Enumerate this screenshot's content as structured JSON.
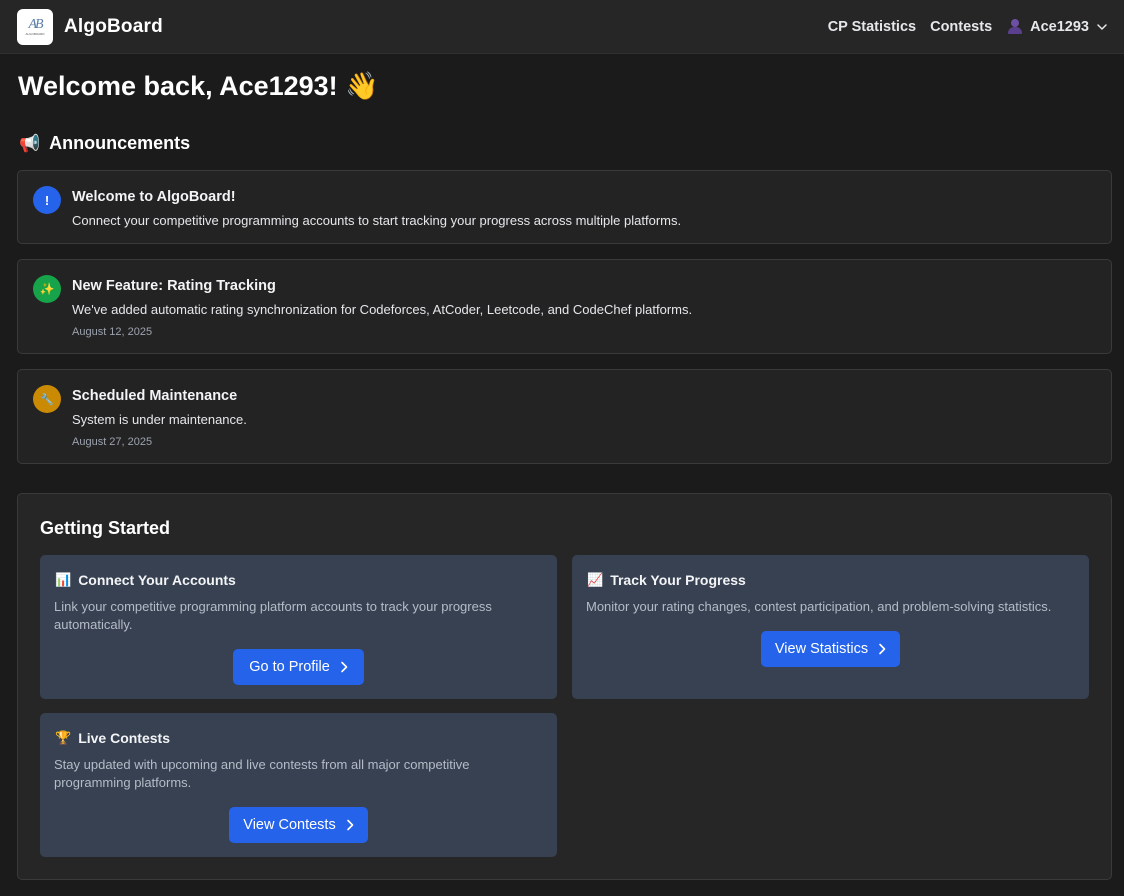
{
  "navbar": {
    "logo_text": "AB",
    "logo_subtext": "ALGOBOARD",
    "brand": "AlgoBoard",
    "links": [
      "CP Statistics",
      "Contests"
    ],
    "username": "Ace1293"
  },
  "welcome": "Welcome back, Ace1293! 👋",
  "announcements": {
    "icon": "📢",
    "heading": "Announcements",
    "items": [
      {
        "icon": "!",
        "icon_color": "#2563eb",
        "title": "Welcome to AlgoBoard!",
        "text": "Connect your competitive programming accounts to start tracking your progress across multiple platforms.",
        "date": ""
      },
      {
        "icon": "✨",
        "icon_color": "#16a34a",
        "title": "New Feature: Rating Tracking",
        "text": "We've added automatic rating synchronization for Codeforces, AtCoder, Leetcode, and CodeChef platforms.",
        "date": "August 12, 2025"
      },
      {
        "icon": "🔧",
        "icon_color": "#ca8a04",
        "title": "Scheduled Maintenance",
        "text": "System is under maintenance.",
        "date": "August 27, 2025"
      }
    ]
  },
  "getting_started": {
    "title": "Getting Started",
    "cards": [
      {
        "icon": "📊",
        "title": "Connect Your Accounts",
        "text": "Link your competitive programming platform accounts to track your progress automatically.",
        "button": "Go to Profile"
      },
      {
        "icon": "📈",
        "title": "Track Your Progress",
        "text": "Monitor your rating changes, contest participation, and problem-solving statistics.",
        "button": "View Statistics"
      },
      {
        "icon": "🏆",
        "title": "Live Contests",
        "text": "Stay updated with upcoming and live contests from all major competitive programming platforms.",
        "button": "View Contests"
      }
    ]
  },
  "colors": {
    "accent": "#2563eb",
    "background": "#1b1b1b",
    "card": "#374151"
  }
}
